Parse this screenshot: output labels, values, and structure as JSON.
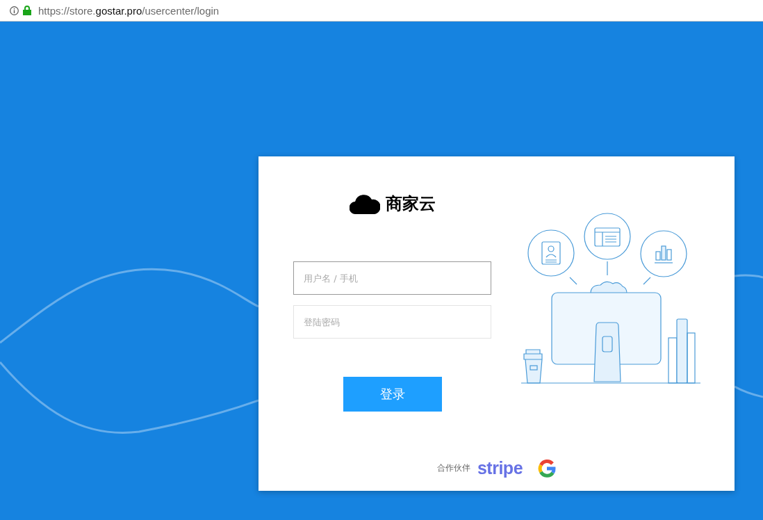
{
  "address_bar": {
    "url": "https://store.**gostar.pro**/usercenter/login",
    "secure": true
  },
  "logo": {
    "text": "商家云"
  },
  "fields": [
    {
      "placeholder": "用户名 / 手机",
      "focused": true
    },
    {
      "placeholder": "登陆密码",
      "focused": false
    }
  ],
  "login_button": {
    "label": "登录"
  },
  "partners": {
    "label": "合作伙伴",
    "stripe": "stripe"
  }
}
